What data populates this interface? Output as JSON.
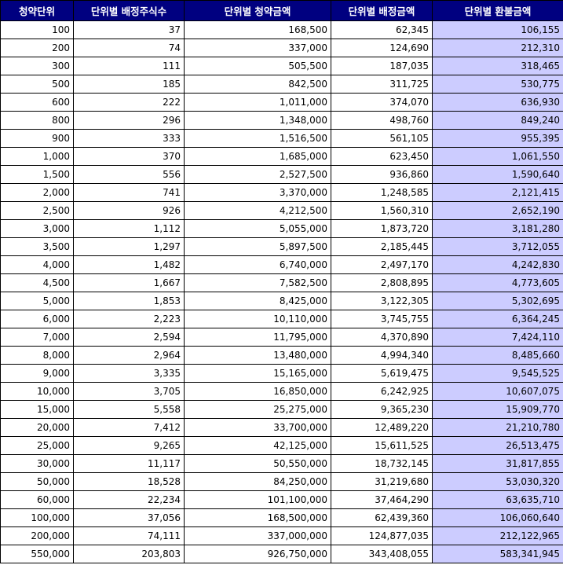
{
  "table": {
    "headers": [
      "청약단위",
      "단위별 배정주식수",
      "단위별 청약금액",
      "단위별 배정금액",
      "단위별 환불금액"
    ],
    "rows": [
      [
        "100",
        "37",
        "168,500",
        "62,345",
        "106,155"
      ],
      [
        "200",
        "74",
        "337,000",
        "124,690",
        "212,310"
      ],
      [
        "300",
        "111",
        "505,500",
        "187,035",
        "318,465"
      ],
      [
        "500",
        "185",
        "842,500",
        "311,725",
        "530,775"
      ],
      [
        "600",
        "222",
        "1,011,000",
        "374,070",
        "636,930"
      ],
      [
        "800",
        "296",
        "1,348,000",
        "498,760",
        "849,240"
      ],
      [
        "900",
        "333",
        "1,516,500",
        "561,105",
        "955,395"
      ],
      [
        "1,000",
        "370",
        "1,685,000",
        "623,450",
        "1,061,550"
      ],
      [
        "1,500",
        "556",
        "2,527,500",
        "936,860",
        "1,590,640"
      ],
      [
        "2,000",
        "741",
        "3,370,000",
        "1,248,585",
        "2,121,415"
      ],
      [
        "2,500",
        "926",
        "4,212,500",
        "1,560,310",
        "2,652,190"
      ],
      [
        "3,000",
        "1,112",
        "5,055,000",
        "1,873,720",
        "3,181,280"
      ],
      [
        "3,500",
        "1,297",
        "5,897,500",
        "2,185,445",
        "3,712,055"
      ],
      [
        "4,000",
        "1,482",
        "6,740,000",
        "2,497,170",
        "4,242,830"
      ],
      [
        "4,500",
        "1,667",
        "7,582,500",
        "2,808,895",
        "4,773,605"
      ],
      [
        "5,000",
        "1,853",
        "8,425,000",
        "3,122,305",
        "5,302,695"
      ],
      [
        "6,000",
        "2,223",
        "10,110,000",
        "3,745,755",
        "6,364,245"
      ],
      [
        "7,000",
        "2,594",
        "11,795,000",
        "4,370,890",
        "7,424,110"
      ],
      [
        "8,000",
        "2,964",
        "13,480,000",
        "4,994,340",
        "8,485,660"
      ],
      [
        "9,000",
        "3,335",
        "15,165,000",
        "5,619,475",
        "9,545,525"
      ],
      [
        "10,000",
        "3,705",
        "16,850,000",
        "6,242,925",
        "10,607,075"
      ],
      [
        "15,000",
        "5,558",
        "25,275,000",
        "9,365,230",
        "15,909,770"
      ],
      [
        "20,000",
        "7,412",
        "33,700,000",
        "12,489,220",
        "21,210,780"
      ],
      [
        "25,000",
        "9,265",
        "42,125,000",
        "15,611,525",
        "26,513,475"
      ],
      [
        "30,000",
        "11,117",
        "50,550,000",
        "18,732,145",
        "31,817,855"
      ],
      [
        "50,000",
        "18,528",
        "84,250,000",
        "31,219,680",
        "53,030,320"
      ],
      [
        "60,000",
        "22,234",
        "101,100,000",
        "37,464,290",
        "63,635,710"
      ],
      [
        "100,000",
        "37,056",
        "168,500,000",
        "62,439,360",
        "106,060,640"
      ],
      [
        "200,000",
        "74,111",
        "337,000,000",
        "124,877,035",
        "212,122,965"
      ],
      [
        "550,000",
        "203,803",
        "926,750,000",
        "343,408,055",
        "583,341,945"
      ]
    ]
  },
  "colors": {
    "header_bg": "#000080",
    "header_text": "#ffffff",
    "refund_column_bg": "#ccccff",
    "border": "#000000"
  }
}
